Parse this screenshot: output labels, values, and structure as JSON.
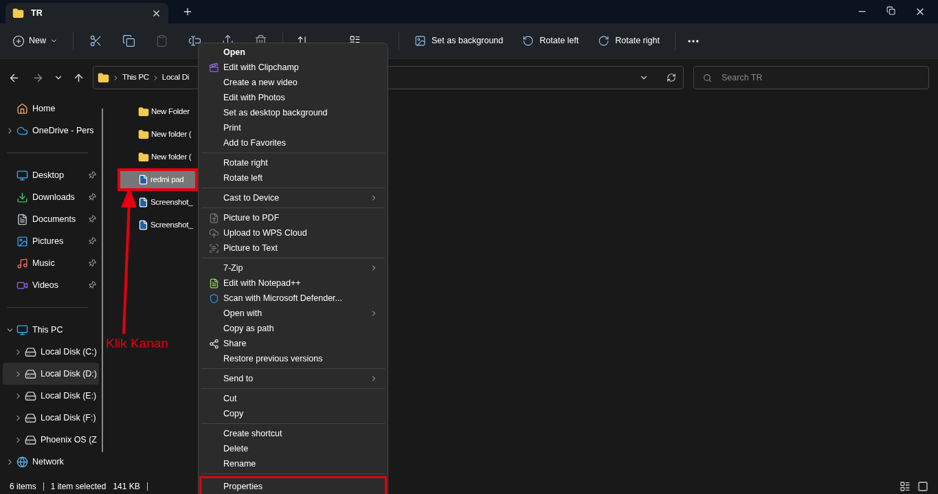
{
  "tab": {
    "title": "TR"
  },
  "toolbar": {
    "new_label": "New",
    "actions": [
      {
        "label": "Set as background"
      },
      {
        "label": "Rotate left"
      },
      {
        "label": "Rotate right"
      }
    ]
  },
  "address": {
    "crumbs": [
      "This PC",
      "Local Di"
    ],
    "search_placeholder": "Search TR"
  },
  "sidebar": {
    "groups": [
      [
        {
          "label": "Home",
          "expandable": false,
          "pinned": false,
          "selected": false
        },
        {
          "label": "OneDrive - Pers",
          "expandable": true,
          "pinned": false,
          "selected": false
        }
      ],
      [
        {
          "label": "Desktop",
          "expandable": false,
          "pinned": true,
          "selected": false
        },
        {
          "label": "Downloads",
          "expandable": false,
          "pinned": true,
          "selected": false
        },
        {
          "label": "Documents",
          "expandable": false,
          "pinned": true,
          "selected": false
        },
        {
          "label": "Pictures",
          "expandable": false,
          "pinned": true,
          "selected": false
        },
        {
          "label": "Music",
          "expandable": false,
          "pinned": true,
          "selected": false
        },
        {
          "label": "Videos",
          "expandable": false,
          "pinned": true,
          "selected": false
        }
      ],
      [
        {
          "label": "This PC",
          "expandable": true,
          "expanded": true,
          "pinned": false,
          "selected": false,
          "children": [
            {
              "label": "Local Disk (C:)",
              "expandable": true,
              "pinned": false,
              "selected": false
            },
            {
              "label": "Local Disk (D:)",
              "expandable": true,
              "pinned": false,
              "selected": true
            },
            {
              "label": "Local Disk (E:)",
              "expandable": true,
              "pinned": false,
              "selected": false
            },
            {
              "label": "Local Disk (F:)",
              "expandable": true,
              "pinned": false,
              "selected": false
            },
            {
              "label": "Phoenix OS (Z",
              "expandable": true,
              "pinned": false,
              "selected": false
            }
          ]
        },
        {
          "label": "Network",
          "expandable": true,
          "pinned": false,
          "selected": false
        }
      ]
    ]
  },
  "files": [
    {
      "name": "New Folder",
      "kind": "folder",
      "selected": false,
      "annotated": false
    },
    {
      "name": "New folder (",
      "kind": "folder",
      "selected": false,
      "annotated": false
    },
    {
      "name": "New folder (",
      "kind": "folder",
      "selected": false,
      "annotated": false
    },
    {
      "name": "redmi pad",
      "kind": "image",
      "selected": true,
      "annotated": true
    },
    {
      "name": "Screenshot_",
      "kind": "image",
      "selected": false,
      "annotated": false
    },
    {
      "name": "Screenshot_",
      "kind": "image",
      "selected": false,
      "annotated": false
    }
  ],
  "annotation": {
    "label": "Klik Kanan"
  },
  "context_menu": [
    [
      {
        "label": "Open",
        "default": true,
        "submenu": false,
        "annotated": false
      },
      {
        "label": "Edit with Clipchamp",
        "default": false,
        "submenu": false,
        "annotated": false
      },
      {
        "label": "Create a new video",
        "default": false,
        "submenu": false,
        "annotated": false
      },
      {
        "label": "Edit with Photos",
        "default": false,
        "submenu": false,
        "annotated": false
      },
      {
        "label": "Set as desktop background",
        "default": false,
        "submenu": false,
        "annotated": false
      },
      {
        "label": "Print",
        "default": false,
        "submenu": false,
        "annotated": false
      },
      {
        "label": "Add to Favorites",
        "default": false,
        "submenu": false,
        "annotated": false
      }
    ],
    [
      {
        "label": "Rotate right",
        "default": false,
        "submenu": false,
        "annotated": false
      },
      {
        "label": "Rotate left",
        "default": false,
        "submenu": false,
        "annotated": false
      }
    ],
    [
      {
        "label": "Cast to Device",
        "default": false,
        "submenu": true,
        "annotated": false
      }
    ],
    [
      {
        "label": "Picture to PDF",
        "default": false,
        "submenu": false,
        "annotated": false
      },
      {
        "label": "Upload to WPS Cloud",
        "default": false,
        "submenu": false,
        "annotated": false
      },
      {
        "label": "Picture to Text",
        "default": false,
        "submenu": false,
        "annotated": false
      }
    ],
    [
      {
        "label": "7-Zip",
        "default": false,
        "submenu": true,
        "annotated": false
      },
      {
        "label": "Edit with Notepad++",
        "default": false,
        "submenu": false,
        "annotated": false
      },
      {
        "label": "Scan with Microsoft Defender...",
        "default": false,
        "submenu": false,
        "annotated": false
      },
      {
        "label": "Open with",
        "default": false,
        "submenu": true,
        "annotated": false
      },
      {
        "label": "Copy as path",
        "default": false,
        "submenu": false,
        "annotated": false
      },
      {
        "label": "Share",
        "default": false,
        "submenu": false,
        "annotated": false
      },
      {
        "label": "Restore previous versions",
        "default": false,
        "submenu": false,
        "annotated": false
      }
    ],
    [
      {
        "label": "Send to",
        "default": false,
        "submenu": true,
        "annotated": false
      }
    ],
    [
      {
        "label": "Cut",
        "default": false,
        "submenu": false,
        "annotated": false
      },
      {
        "label": "Copy",
        "default": false,
        "submenu": false,
        "annotated": false
      }
    ],
    [
      {
        "label": "Create shortcut",
        "default": false,
        "submenu": false,
        "annotated": false
      },
      {
        "label": "Delete",
        "default": false,
        "submenu": false,
        "annotated": false
      },
      {
        "label": "Rename",
        "default": false,
        "submenu": false,
        "annotated": false
      }
    ],
    [
      {
        "label": "Properties",
        "default": false,
        "submenu": false,
        "annotated": true
      }
    ]
  ],
  "status_bar": {
    "count": "6 items",
    "selection": "1 item selected",
    "size": "141 KB"
  }
}
